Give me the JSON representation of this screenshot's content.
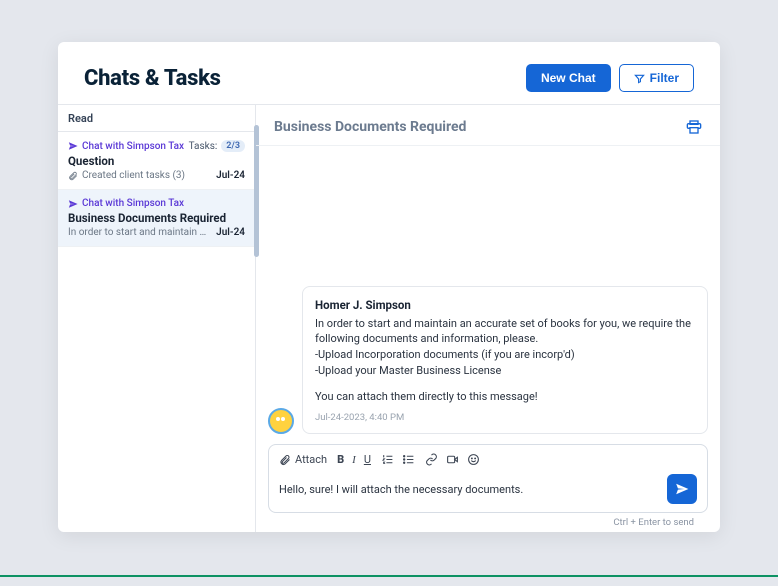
{
  "header": {
    "title": "Chats & Tasks",
    "new_chat_label": "New Chat",
    "filter_label": "Filter"
  },
  "sidebar": {
    "section_label": "Read",
    "items": [
      {
        "firm": "Chat with Simpson Tax",
        "tasks_label": "Tasks:",
        "tasks_count": "2/3",
        "subject": "Question",
        "preview": "Created client tasks (3)",
        "date": "Jul-24",
        "has_attachment": true
      },
      {
        "firm": "Chat with Simpson Tax",
        "subject": "Business Documents Required",
        "preview": "In order to start and maintain an ac…",
        "date": "Jul-24",
        "selected": true
      }
    ]
  },
  "thread": {
    "title": "Business Documents Required",
    "message": {
      "sender": "Homer J. Simpson",
      "line1": "In order to start and maintain an accurate set of books for you, we require the following documents and information, please.",
      "line2": "-Upload Incorporation documents (if you are incorp'd)",
      "line3": "-Upload your Master Business License",
      "line4": "You can attach them directly to this message!",
      "timestamp": "Jul-24-2023, 4:40 PM"
    }
  },
  "composer": {
    "attach_label": "Attach",
    "value": "Hello, sure! I will attach the necessary documents.",
    "hint": "Ctrl + Enter to send"
  }
}
